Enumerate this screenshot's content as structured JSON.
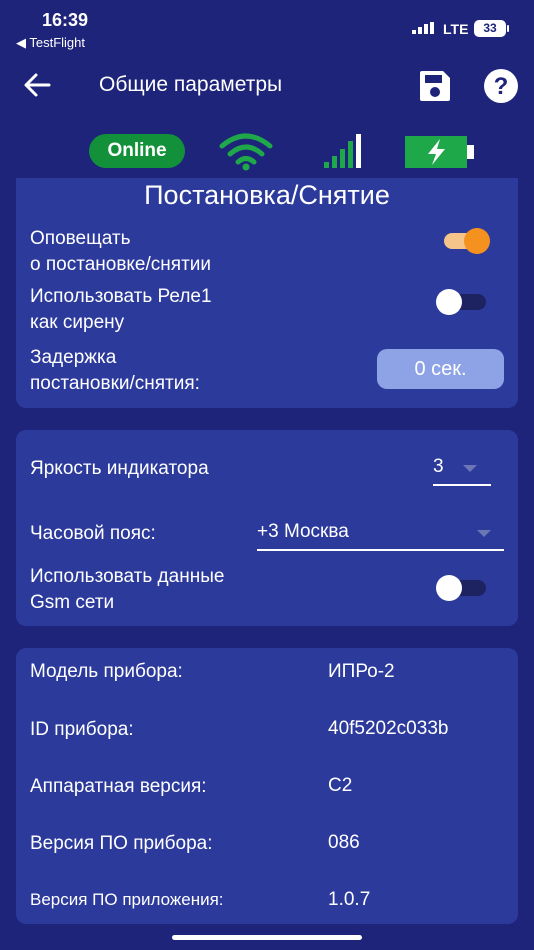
{
  "status_bar": {
    "time": "16:39",
    "back_app": "◀ TestFlight",
    "network": "LTE",
    "battery": "33"
  },
  "header": {
    "title": "Общие параметры",
    "back_icon": "arrow-left-icon",
    "save_icon": "save-icon",
    "help_icon": "help-icon"
  },
  "indicators": {
    "online_label": "Online",
    "online_color": "#12913a",
    "wifi_color": "#1fa84a",
    "signal_color": "#1fa84a",
    "battery_color": "#1fa84a"
  },
  "arming": {
    "title": "Постановка/Снятие",
    "notify_label_1": "Оповещать",
    "notify_label_2": "о постановке/снятии",
    "notify_on": true,
    "relay_label_1": "Использовать Реле1",
    "relay_label_2": "как сирену",
    "relay_on": false,
    "delay_label_1": "Задержка",
    "delay_label_2": "постановки/снятия:",
    "delay_value": "0 сек."
  },
  "settings": {
    "brightness_label": "Яркость индикатора",
    "brightness_value": "3",
    "timezone_label": "Часовой пояс:",
    "timezone_value": "+3 Москва",
    "gsm_label_1": "Использовать данные",
    "gsm_label_2": "Gsm сети",
    "gsm_on": false
  },
  "device_info": {
    "model_label": "Модель прибора:",
    "model_value": "ИПРо-2",
    "id_label": "ID прибора:",
    "id_value": "40f5202c033b",
    "hw_label": "Аппаратная версия:",
    "hw_value": "C2",
    "fw_label": "Версия ПО прибора:",
    "fw_value": "086",
    "app_label": "Версия ПО приложения:",
    "app_value": "1.0.7"
  },
  "colors": {
    "background": "#1d2479",
    "card": "#2c3a9c",
    "toggle_on": "#f5911e",
    "button": "#8ea2e6"
  }
}
